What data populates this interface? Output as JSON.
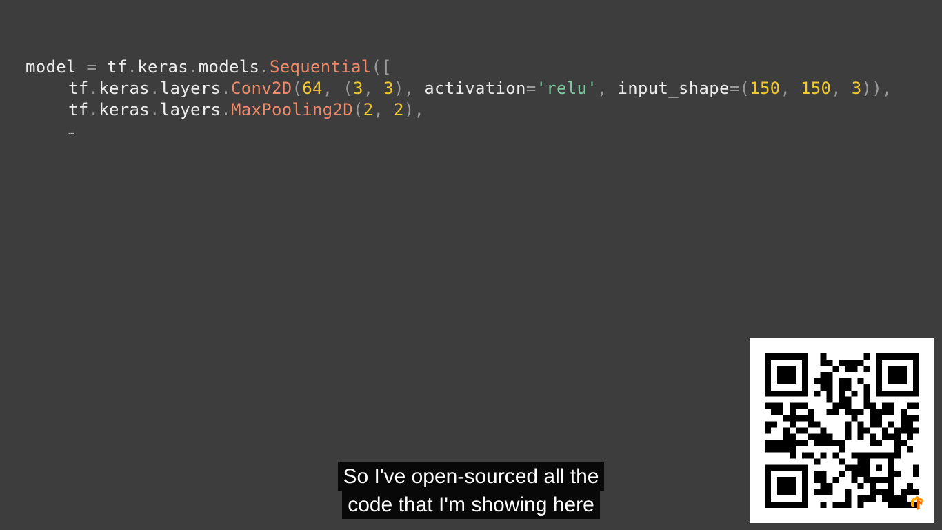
{
  "code": {
    "line1": {
      "p1": "model",
      "p2": " = ",
      "p3": "tf",
      "p4": ".",
      "p5": "keras",
      "p6": ".",
      "p7": "models",
      "p8": ".",
      "p9": "Sequential",
      "p10": "(["
    },
    "line2": {
      "p1": "tf",
      "p2": ".",
      "p3": "keras",
      "p4": ".",
      "p5": "layers",
      "p6": ".",
      "p7": "Conv2D",
      "p8": "(",
      "p9": "64",
      "p10": ", (",
      "p11": "3",
      "p12": ", ",
      "p13": "3",
      "p14": "), ",
      "p15": "activation",
      "p16": "=",
      "p17": "'relu'",
      "p18": ", ",
      "p19": "input_shape",
      "p20": "=(",
      "p21": "150",
      "p22": ", ",
      "p23": "150",
      "p24": ", ",
      "p25": "3",
      "p26": ")),"
    },
    "line3": {
      "p1": "tf",
      "p2": ".",
      "p3": "keras",
      "p4": ".",
      "p5": "layers",
      "p6": ".",
      "p7": "MaxPooling2D",
      "p8": "(",
      "p9": "2",
      "p10": ", ",
      "p11": "2",
      "p12": "),"
    },
    "line4": {
      "p1": "…"
    }
  },
  "caption": {
    "line1": "So I've open-sourced all the",
    "line2": "code that I'm showing here"
  },
  "colors": {
    "background": "#3c3d3c",
    "code_text": "#ececec",
    "code_punct": "#9a9a9a",
    "code_function": "#ee8a6a",
    "code_number": "#f2c833",
    "code_string": "#7dc9a2",
    "caption_bg": "#080808",
    "caption_text": "#ffffff",
    "tf_logo": "#ff8f00"
  },
  "icons": {
    "qr": "qr-code-icon",
    "logo": "tensorflow-logo-icon"
  }
}
